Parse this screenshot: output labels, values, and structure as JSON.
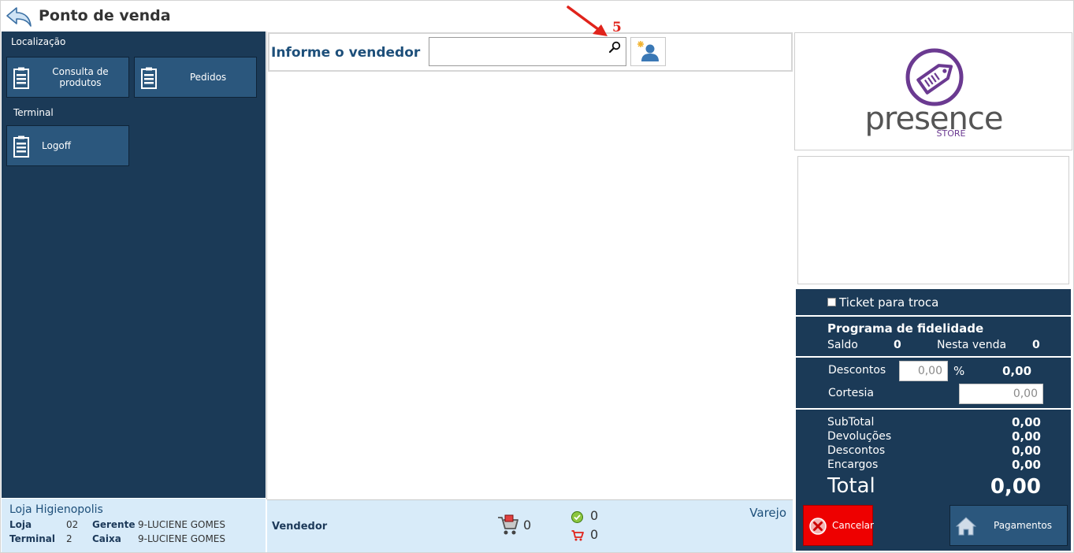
{
  "title": "Ponto de venda",
  "sidebar": {
    "section_localizacao": "Localização",
    "btn_consulta": "Consulta de\nprodutos",
    "btn_pedidos": "Pedidos",
    "section_terminal": "Terminal",
    "btn_logoff": "Logoff"
  },
  "store": {
    "name": "Loja Higienopolis",
    "loja_label": "Loja",
    "loja_value": "02",
    "gerente_label": "Gerente",
    "gerente_value": "9-LUCIENE GOMES",
    "terminal_label": "Terminal",
    "terminal_value": "2",
    "caixa_label": "Caixa",
    "caixa_value": "9-LUCIENE GOMES"
  },
  "seller": {
    "label": "Informe o vendedor",
    "input_value": ""
  },
  "annotation": {
    "number": "5"
  },
  "center_footer": {
    "vendor_label": "Vendedor",
    "cart_count": "0",
    "ok_count": "0",
    "minicart_count": "0",
    "price_list": "Varejo"
  },
  "logo": {
    "brand": "presence",
    "sub": "STORE",
    "color": "#6b3a91"
  },
  "summary": {
    "ticket_label": "Ticket para troca",
    "fidelity_title": "Programa de fidelidade",
    "saldo_label": "Saldo",
    "saldo_value": "0",
    "nesta_venda_label": "Nesta venda",
    "nesta_venda_value": "0",
    "descontos_label": "Descontos",
    "descontos_input": "0,00",
    "percent": "%",
    "descontos_value": "0,00",
    "cortesia_label": "Cortesia",
    "cortesia_input": "0,00",
    "subtotal_label": "SubTotal",
    "subtotal_value": "0,00",
    "devolucoes_label": "Devoluções",
    "devolucoes_value": "0,00",
    "descontos2_label": "Descontos",
    "descontos2_value": "0,00",
    "encargos_label": "Encargos",
    "encargos_value": "0,00",
    "total_label": "Total",
    "total_value": "0,00"
  },
  "actions": {
    "cancel_label": "Cancelar",
    "pay_label": "Pagamentos"
  },
  "colors": {
    "sidebar_bg": "#1b3a57",
    "button_bg": "#2b577d",
    "footer_bg": "#d8ebf9",
    "cancel_bg": "#ee0000",
    "annotation_red": "#e0231b"
  }
}
